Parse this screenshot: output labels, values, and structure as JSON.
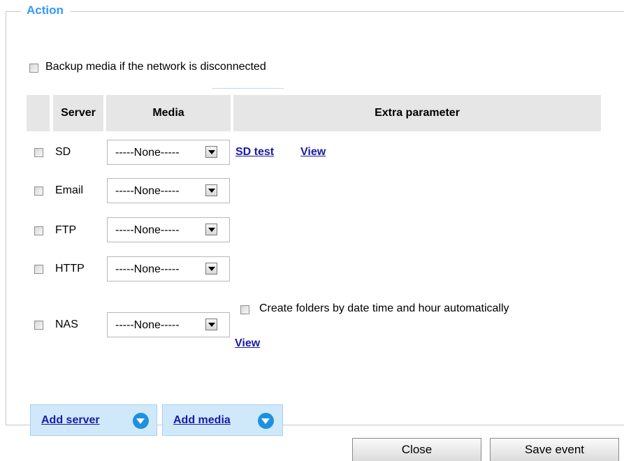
{
  "section_title": "Action",
  "backup_label": "Backup media if the network is disconnected",
  "table": {
    "headers": [
      "Server",
      "Media",
      "Extra parameter"
    ]
  },
  "rows": [
    {
      "server": "SD",
      "media": "-----None-----",
      "links": [
        "SD test",
        "View"
      ]
    },
    {
      "server": "Email",
      "media": "-----None-----"
    },
    {
      "server": "FTP",
      "media": "-----None-----"
    },
    {
      "server": "HTTP",
      "media": "-----None-----"
    },
    {
      "server": "NAS",
      "media": "-----None-----",
      "folders_label": "Create folders by date time and hour automatically",
      "view_link": "View"
    }
  ],
  "add_server_label": "Add server",
  "add_media_label": "Add media",
  "close_label": "Close",
  "save_label": "Save event",
  "icons": {
    "add_server": "chevron-down-circle-icon",
    "add_media": "chevron-down-circle-icon"
  }
}
